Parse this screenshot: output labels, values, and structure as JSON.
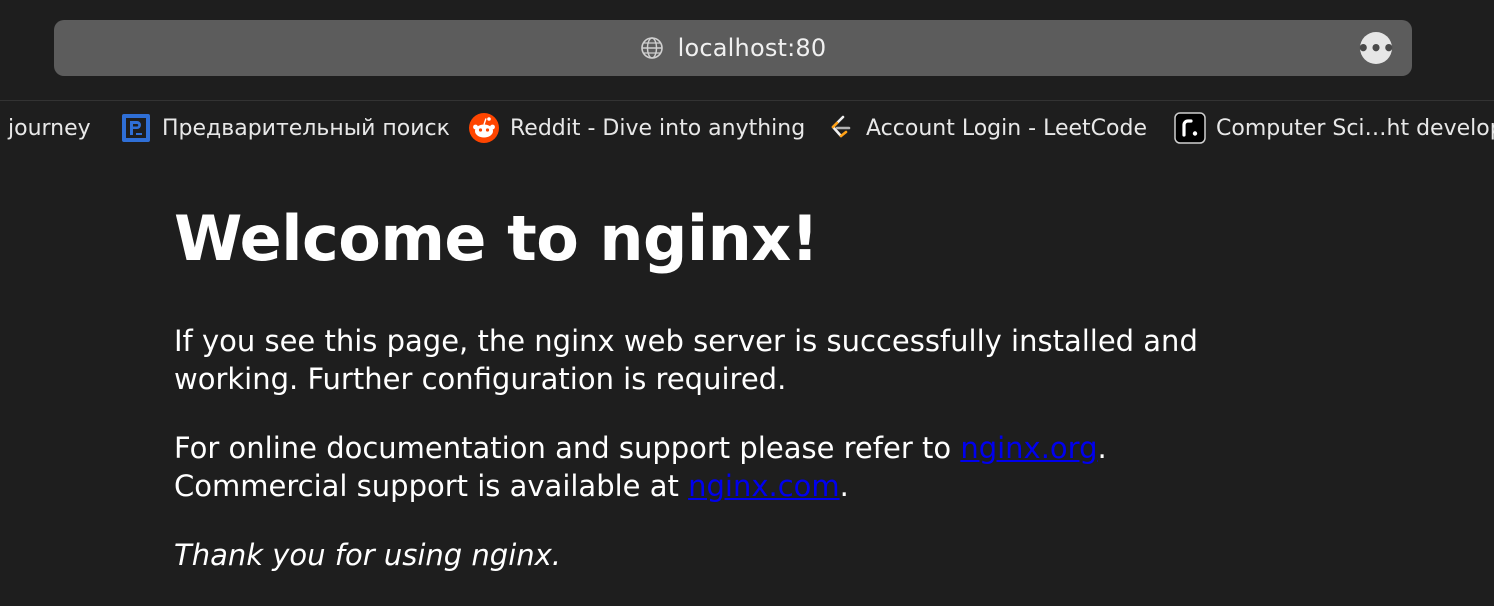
{
  "browser": {
    "url": "localhost:80",
    "more_label": "•••"
  },
  "bookmarks": [
    {
      "label": "journey",
      "icon": "none"
    },
    {
      "label": "Предварительный поиск",
      "icon": "p-square-icon"
    },
    {
      "label": "Reddit - Dive into anything",
      "icon": "reddit-icon"
    },
    {
      "label": "Account Login - LeetCode",
      "icon": "leetcode-icon"
    },
    {
      "label": "Computer Sci…ht develope",
      "icon": "r-square-icon"
    }
  ],
  "page": {
    "heading": "Welcome to nginx!",
    "para1": "If you see this page, the nginx web server is successfully installed and working. Further configuration is required.",
    "para2_prefix": "For online documentation and support please refer to ",
    "link1": "nginx.org",
    "para2_mid": ".",
    "para2_second_prefix": "Commercial support is available at ",
    "link2": "nginx.com",
    "para2_suffix": ".",
    "para3": "Thank you for using nginx."
  },
  "colors": {
    "background": "#1e1e1e",
    "link": "#0000ee",
    "address_bar": "#5c5c5c"
  }
}
